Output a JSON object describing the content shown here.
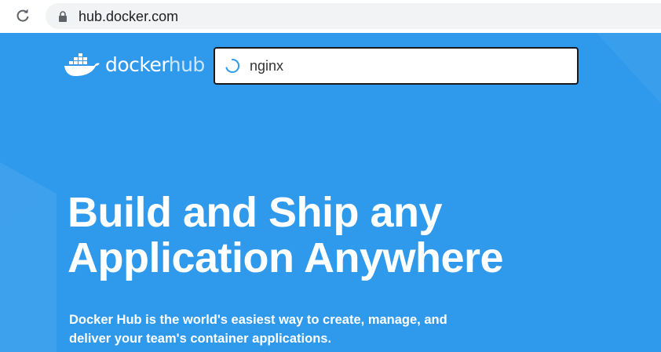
{
  "browser": {
    "url": "hub.docker.com"
  },
  "header": {
    "logo_docker": "docker",
    "logo_hub": "hub",
    "search": {
      "value": "nginx",
      "placeholder": ""
    }
  },
  "hero": {
    "title_line1": "Build and Ship any",
    "title_line2": "Application Anywhere",
    "subtitle_line1": "Docker Hub is the world's easiest way to create, manage, and",
    "subtitle_line2": "deliver your team's container applications."
  },
  "colors": {
    "hero_background": "#2f99ec",
    "text_on_hero": "#ffffff"
  },
  "icons": [
    "reload-icon",
    "lock-icon",
    "docker-whale-logo",
    "loading-spinner-icon"
  ]
}
